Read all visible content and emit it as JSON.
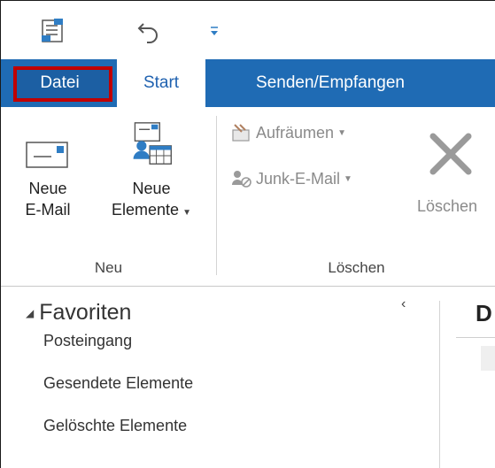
{
  "tabs": {
    "file_label": "Datei",
    "start_label": "Start",
    "send_receive_label": "Senden/Empfangen"
  },
  "ribbon": {
    "new_email_line1": "Neue",
    "new_email_line2": "E-Mail",
    "new_items_line1": "Neue",
    "new_items_line2": "Elemente",
    "group_new": "Neu",
    "cleanup_label": "Aufräumen",
    "junk_label": "Junk-E-Mail",
    "delete_label": "Löschen",
    "group_delete": "Löschen"
  },
  "folders": {
    "favorites_header": "Favoriten",
    "items": [
      {
        "label": "Posteingang"
      },
      {
        "label": "Gesendete Elemente"
      },
      {
        "label": "Gelöschte Elemente"
      }
    ]
  },
  "right_pane": {
    "title_initial": "D"
  },
  "colors": {
    "tab_bar": "#1f6bb4",
    "highlight": "#c00000",
    "text": "#222222",
    "disabled": "#8a8a8a"
  }
}
